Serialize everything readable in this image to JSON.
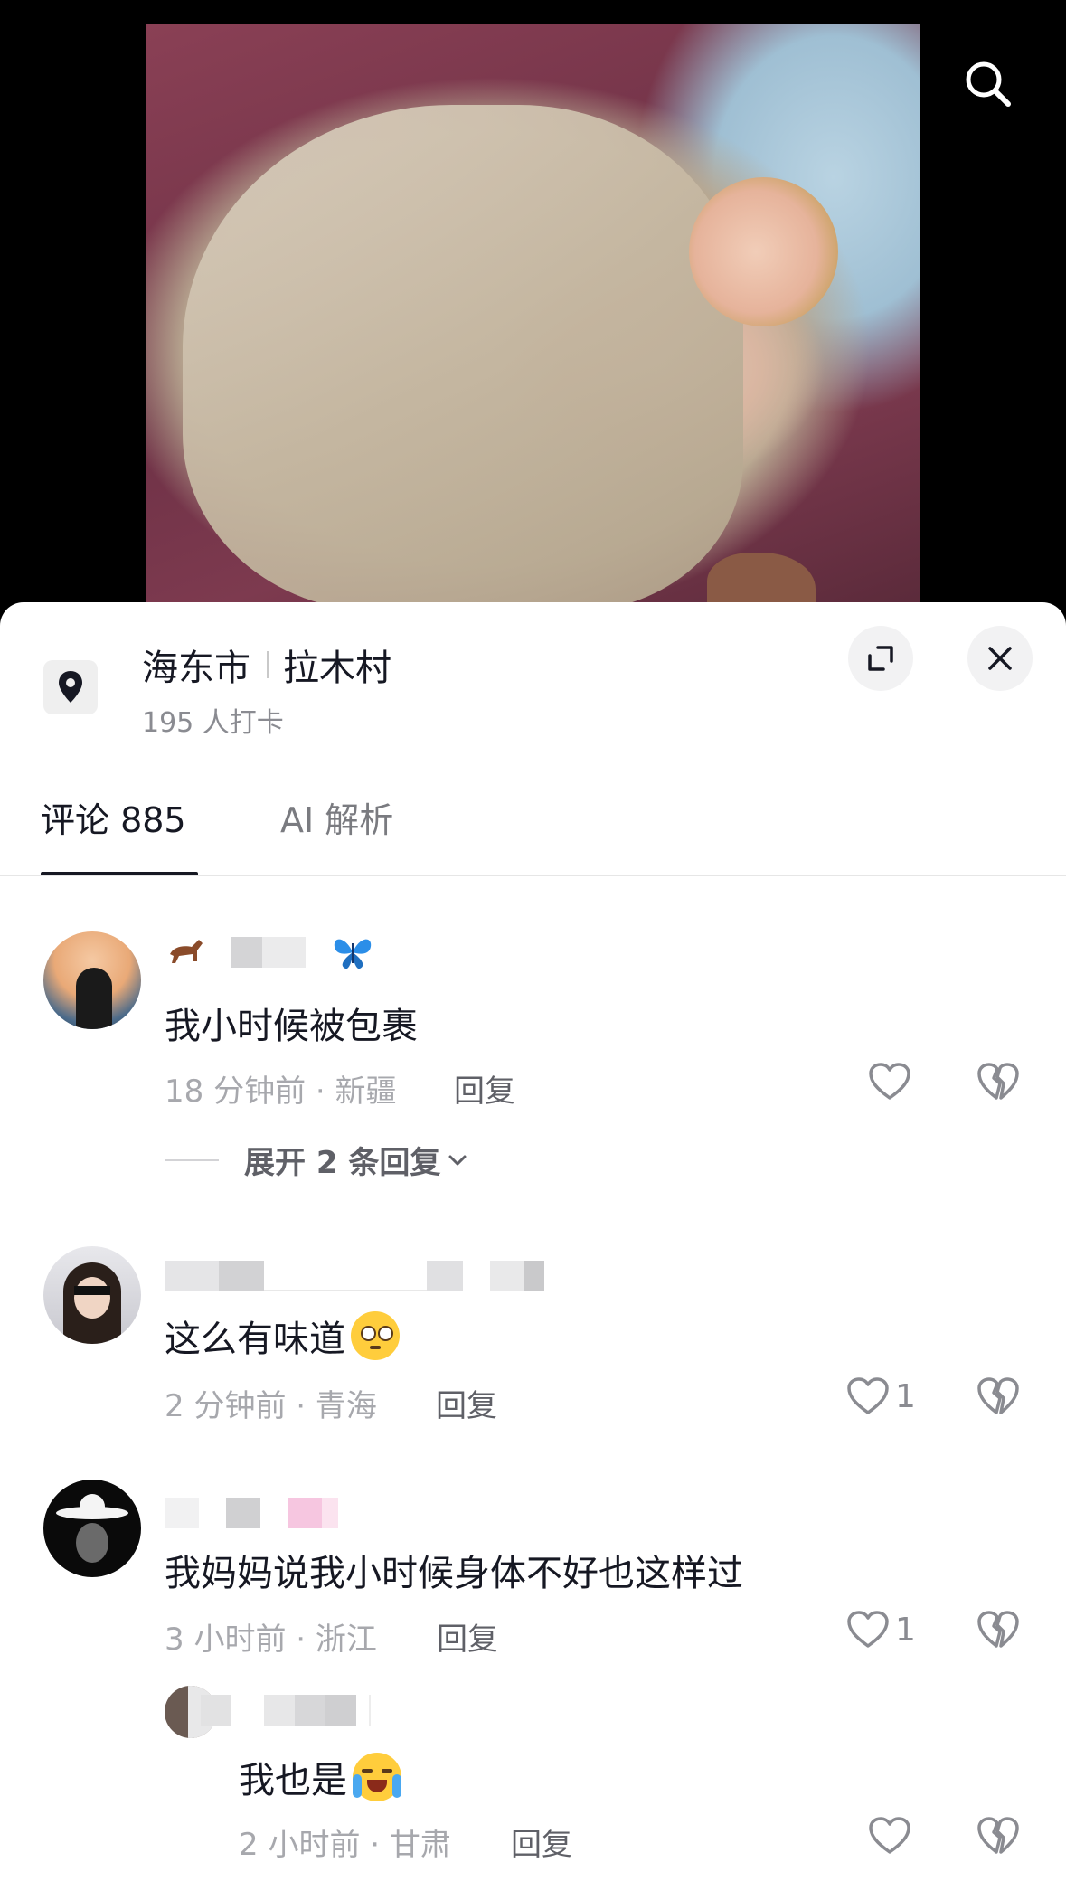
{
  "location": {
    "city": "海东市",
    "village": "拉木村",
    "checkins": "195 人打卡"
  },
  "tabs": {
    "comments": "评论 885",
    "ai": "AI 解析"
  },
  "comments": [
    {
      "text": "我小时候被包裹",
      "meta": "18 分钟前 · 新疆",
      "reply": "回复",
      "likes": "",
      "expand": "展开 2 条回复"
    },
    {
      "text": "这么有味道",
      "meta": "2 分钟前 · 青海",
      "reply": "回复",
      "likes": "1"
    },
    {
      "text": "我妈妈说我小时候身体不好也这样过",
      "meta": "3 小时前 · 浙江",
      "reply": "回复",
      "likes": "1"
    }
  ],
  "reply_comment": {
    "text": "我也是",
    "meta": "2 小时前 · 甘肃",
    "reply": "回复"
  },
  "colors": {
    "text_primary": "#161823",
    "text_secondary": "#a7a8ad",
    "sheet_bg": "#ffffff"
  }
}
